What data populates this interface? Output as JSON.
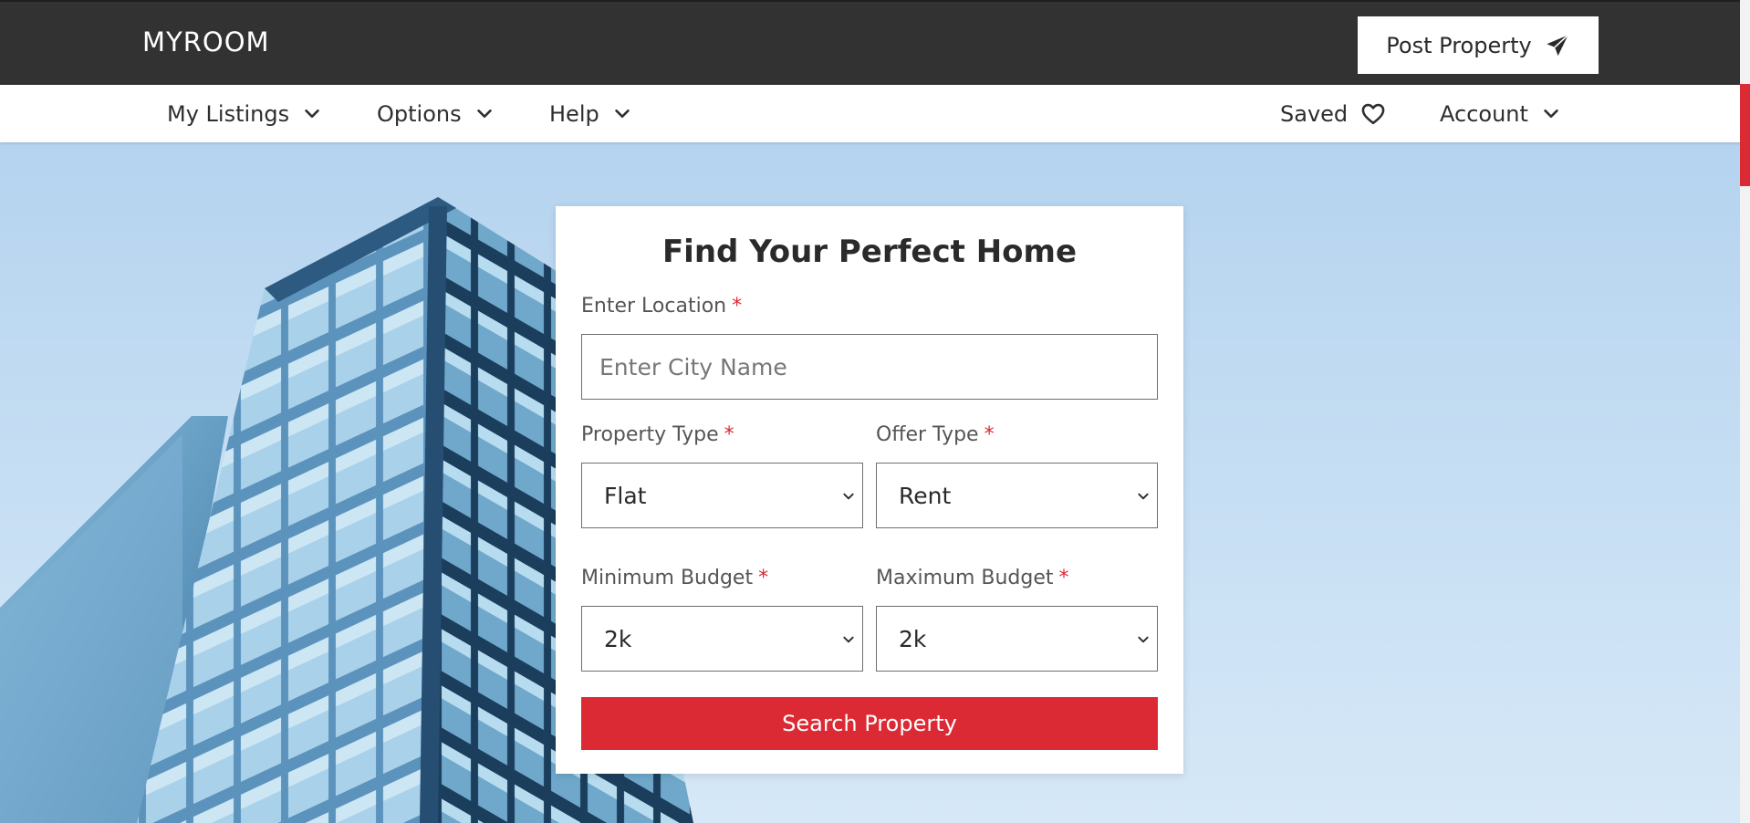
{
  "header": {
    "brand": "MYROOM",
    "post_property_label": "Post Property"
  },
  "nav": {
    "my_listings": "My Listings",
    "options": "Options",
    "help": "Help",
    "saved": "Saved",
    "account": "Account"
  },
  "search_card": {
    "title": "Find Your Perfect Home",
    "location_label": "Enter Location",
    "location_placeholder": "Enter City Name",
    "location_value": "",
    "property_type_label": "Property Type",
    "property_type_value": "Flat",
    "offer_type_label": "Offer Type",
    "offer_type_value": "Rent",
    "min_budget_label": "Minimum Budget",
    "min_budget_value": "2k",
    "max_budget_label": "Maximum Budget",
    "max_budget_value": "2k",
    "required_marker": "*",
    "search_button_label": "Search Property"
  },
  "icons": {
    "post": "paper-plane-icon",
    "dropdown": "chevron-down-icon",
    "saved": "heart-icon"
  },
  "colors": {
    "topbar": "#323232",
    "accent": "#dc2a34",
    "sky": "#c4ddf3"
  }
}
